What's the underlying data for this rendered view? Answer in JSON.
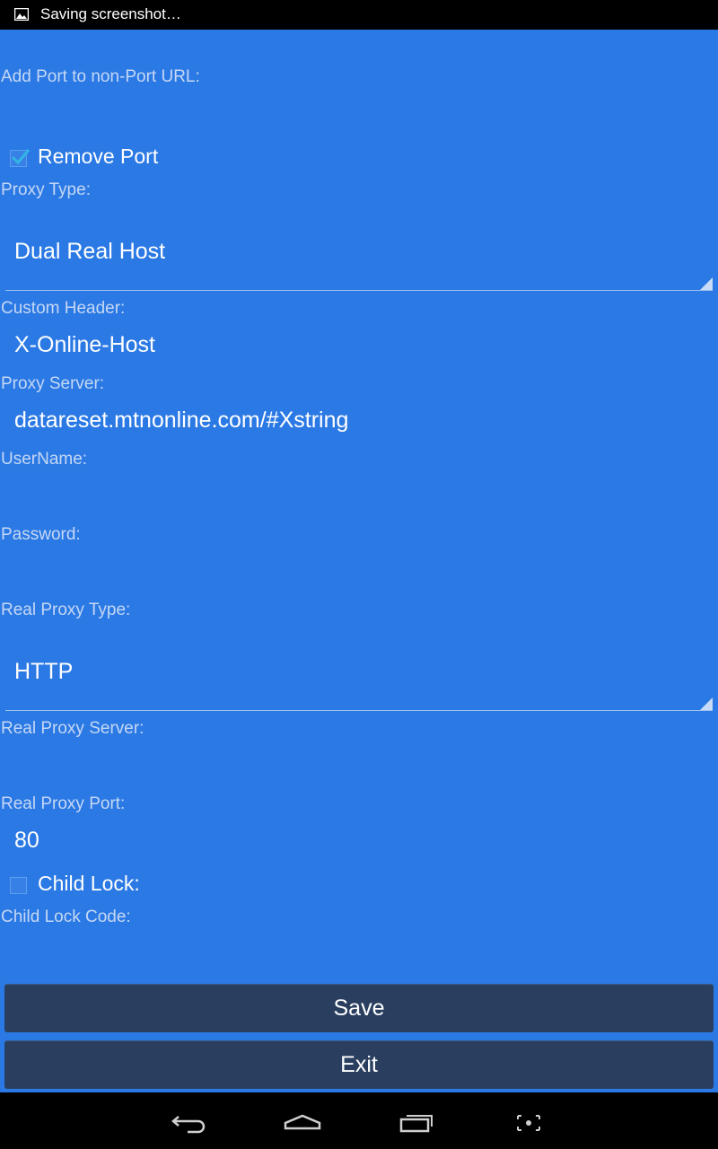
{
  "statusbar": {
    "text": "Saving screenshot…",
    "icon": "image-icon"
  },
  "form": {
    "add_port_label": "Add Port to non-Port URL:",
    "remove_port": {
      "label": "Remove Port",
      "checked": true
    },
    "proxy_type_label": "Proxy Type:",
    "proxy_type_value": "Dual Real Host",
    "custom_header_label": "Custom Header:",
    "custom_header_value": "X-Online-Host",
    "proxy_server_label": "Proxy Server:",
    "proxy_server_value": "datareset.mtnonline.com/#Xstring",
    "username_label": "UserName:",
    "username_value": "",
    "password_label": "Password:",
    "password_value": "",
    "real_proxy_type_label": "Real Proxy Type:",
    "real_proxy_type_value": "HTTP",
    "real_proxy_server_label": "Real Proxy Server:",
    "real_proxy_server_value": "",
    "real_proxy_port_label": "Real Proxy Port:",
    "real_proxy_port_value": "80",
    "child_lock": {
      "label": "Child Lock:",
      "checked": false
    },
    "child_lock_code_label": "Child Lock Code:",
    "child_lock_code_value": ""
  },
  "buttons": {
    "save": "Save",
    "exit": "Exit"
  },
  "navbar": {
    "icons": [
      "back-icon",
      "home-icon",
      "recent-apps-icon",
      "screenshot-icon"
    ]
  },
  "colors": {
    "background": "#2b79e4",
    "button": "#2a3f5f",
    "label": "#c5d8f5",
    "accent_check": "#33b5e5"
  }
}
